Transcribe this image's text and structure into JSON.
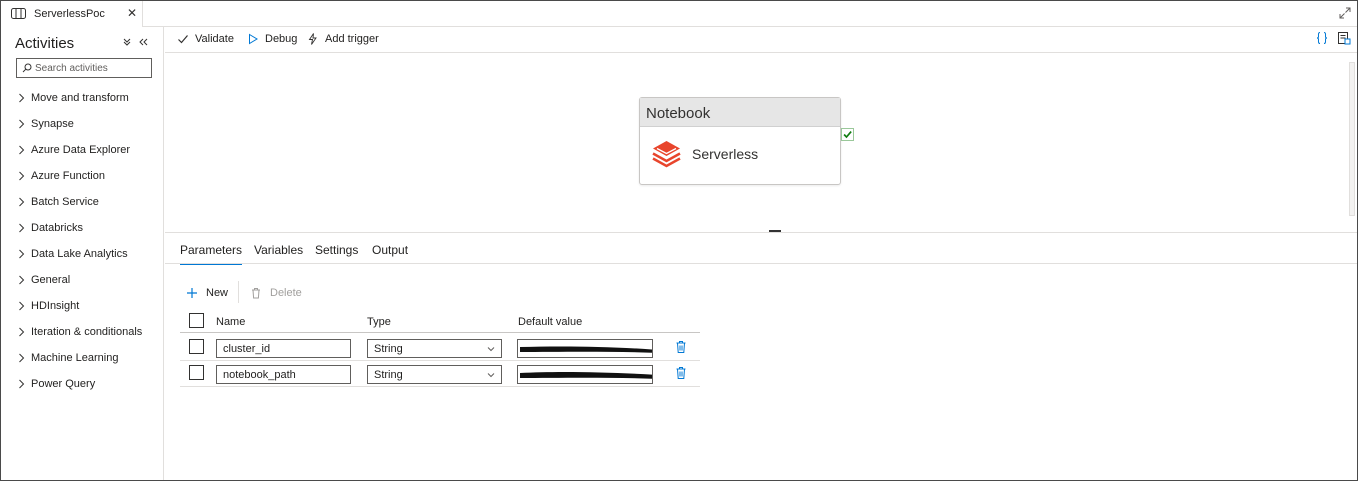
{
  "tab": {
    "title": "ServerlessPoc",
    "close": "✕"
  },
  "sidebar": {
    "title": "Activities",
    "search_placeholder": "Search activities",
    "items": [
      {
        "label": "Move and transform"
      },
      {
        "label": "Synapse"
      },
      {
        "label": "Azure Data Explorer"
      },
      {
        "label": "Azure Function"
      },
      {
        "label": "Batch Service"
      },
      {
        "label": "Databricks"
      },
      {
        "label": "Data Lake Analytics"
      },
      {
        "label": "General"
      },
      {
        "label": "HDInsight"
      },
      {
        "label": "Iteration & conditionals"
      },
      {
        "label": "Machine Learning"
      },
      {
        "label": "Power Query"
      }
    ]
  },
  "toolbar": {
    "validate": "Validate",
    "debug": "Debug",
    "add_trigger": "Add trigger"
  },
  "canvas": {
    "activity_type": "Notebook",
    "activity_name": "Serverless",
    "status": "succeeded"
  },
  "panel": {
    "tabs": [
      "Parameters",
      "Variables",
      "Settings",
      "Output"
    ],
    "active_tab": "Parameters",
    "new_label": "New",
    "delete_label": "Delete",
    "columns": {
      "name": "Name",
      "type": "Type",
      "default": "Default value"
    },
    "rows": [
      {
        "name": "cluster_id",
        "type": "String",
        "default": ""
      },
      {
        "name": "notebook_path",
        "type": "String",
        "default": ""
      }
    ]
  },
  "colors": {
    "accent": "#0078d4",
    "databricks": "#e8452c",
    "success": "#107c10"
  }
}
